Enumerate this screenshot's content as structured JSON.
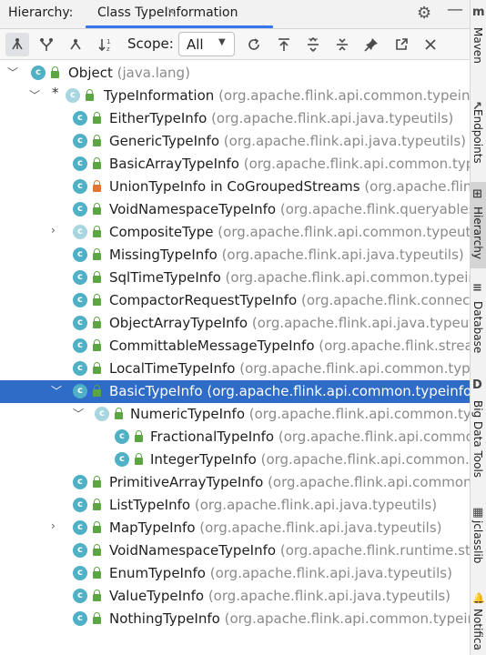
{
  "header": {
    "title": "Hierarchy:",
    "tab_label": "Class TypeInformation",
    "tab_close": "×",
    "gear": "⚙",
    "minimize": "—"
  },
  "toolbar": {
    "scope_label": "Scope:",
    "scope_value": "All",
    "buttons": [
      "subtypes-hierarchy",
      "supertypes-hierarchy",
      "class-hierarchy",
      "sort-alphabetically",
      "refresh",
      "navigate-up",
      "expand-all",
      "collapse-all",
      "pin",
      "open-in-window",
      "close"
    ]
  },
  "tree": {
    "rows": [
      {
        "name": "Object",
        "pkg": "(java.lang)"
      },
      {
        "name": "TypeInformation",
        "pkg": "(org.apache.flink.api.common.typeinfo"
      },
      {
        "name": "EitherTypeInfo",
        "pkg": "(org.apache.flink.api.java.typeutils)"
      },
      {
        "name": "GenericTypeInfo",
        "pkg": "(org.apache.flink.api.java.typeutils)"
      },
      {
        "name": "BasicArrayTypeInfo",
        "pkg": "(org.apache.flink.api.common.type"
      },
      {
        "name": "UnionTypeInfo in CoGroupedStreams",
        "pkg": "(org.apache.flink"
      },
      {
        "name": "VoidNamespaceTypeInfo",
        "pkg": "(org.apache.flink.queryablest"
      },
      {
        "name": "CompositeType",
        "pkg": "(org.apache.flink.api.common.typeutil"
      },
      {
        "name": "MissingTypeInfo",
        "pkg": "(org.apache.flink.api.java.typeutils)"
      },
      {
        "name": "SqlTimeTypeInfo",
        "pkg": "(org.apache.flink.api.common.typeinf"
      },
      {
        "name": "CompactorRequestTypeInfo",
        "pkg": "(org.apache.flink.connecte"
      },
      {
        "name": "ObjectArrayTypeInfo",
        "pkg": "(org.apache.flink.api.java.typeutil"
      },
      {
        "name": "CommittableMessageTypeInfo",
        "pkg": "(org.apache.flink.stream"
      },
      {
        "name": "LocalTimeTypeInfo",
        "pkg": "(org.apache.flink.api.common.type"
      },
      {
        "name": "BasicTypeInfo",
        "pkg": "(org.apache.flink.api.common.typeinfo)"
      },
      {
        "name": "NumericTypeInfo",
        "pkg": "(org.apache.flink.api.common.typ"
      },
      {
        "name": "FractionalTypeInfo",
        "pkg": "(org.apache.flink.api.commor"
      },
      {
        "name": "IntegerTypeInfo",
        "pkg": "(org.apache.flink.api.common.ty"
      },
      {
        "name": "PrimitiveArrayTypeInfo",
        "pkg": "(org.apache.flink.api.common.t"
      },
      {
        "name": "ListTypeInfo",
        "pkg": "(org.apache.flink.api.java.typeutils)"
      },
      {
        "name": "MapTypeInfo",
        "pkg": "(org.apache.flink.api.java.typeutils)"
      },
      {
        "name": "VoidNamespaceTypeInfo",
        "pkg": "(org.apache.flink.runtime.stat"
      },
      {
        "name": "EnumTypeInfo",
        "pkg": "(org.apache.flink.api.java.typeutils)"
      },
      {
        "name": "ValueTypeInfo",
        "pkg": "(org.apache.flink.api.java.typeutils)"
      },
      {
        "name": "NothingTypeInfo",
        "pkg": "(org.apache.flink.api.common.typeint"
      }
    ]
  },
  "side_strip": {
    "items": [
      {
        "label": "Maven",
        "icon": "m"
      },
      {
        "label": "Endpoints",
        "icon": "↗"
      },
      {
        "label": "Hierarchy",
        "icon": "⊞"
      },
      {
        "label": "Database",
        "icon": "≡"
      },
      {
        "label": "Big Data Tools",
        "icon": "D"
      },
      {
        "label": "jclasslib",
        "icon": "▦"
      },
      {
        "label": "Notifica",
        "icon": "🔔"
      }
    ]
  },
  "colors": {
    "selection": "#2f6cc8",
    "class_icon": "#4fb0c6",
    "public_lock": "#5ba642",
    "private_lock": "#e0762f",
    "package_text": "#8a8a8a",
    "tab_underline": "#3574f0"
  }
}
